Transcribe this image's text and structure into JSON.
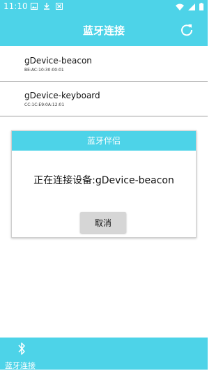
{
  "status_bar": {
    "time": "11:10",
    "left_icons": [
      "image-icon",
      "download-icon",
      "blocked-icon"
    ],
    "right_icons": [
      "wifi-icon",
      "signal-icon",
      "battery-icon"
    ]
  },
  "app_bar": {
    "title": "蓝牙连接",
    "action_icon": "refresh-icon"
  },
  "devices": [
    {
      "name": "gDevice-beacon",
      "mac": "BE:AC:10:30:00:01"
    },
    {
      "name": "gDevice-keyboard",
      "mac": "CC:1C:E9:0A:12:01"
    }
  ],
  "dialog": {
    "title": "蓝牙伴侣",
    "message": "正在连接设备:gDevice-beacon",
    "cancel_label": "取消"
  },
  "bottom_nav": {
    "icon": "bluetooth-icon",
    "label": "蓝牙连接"
  },
  "colors": {
    "accent": "#4dd3e8",
    "button": "#d6d6d6"
  }
}
